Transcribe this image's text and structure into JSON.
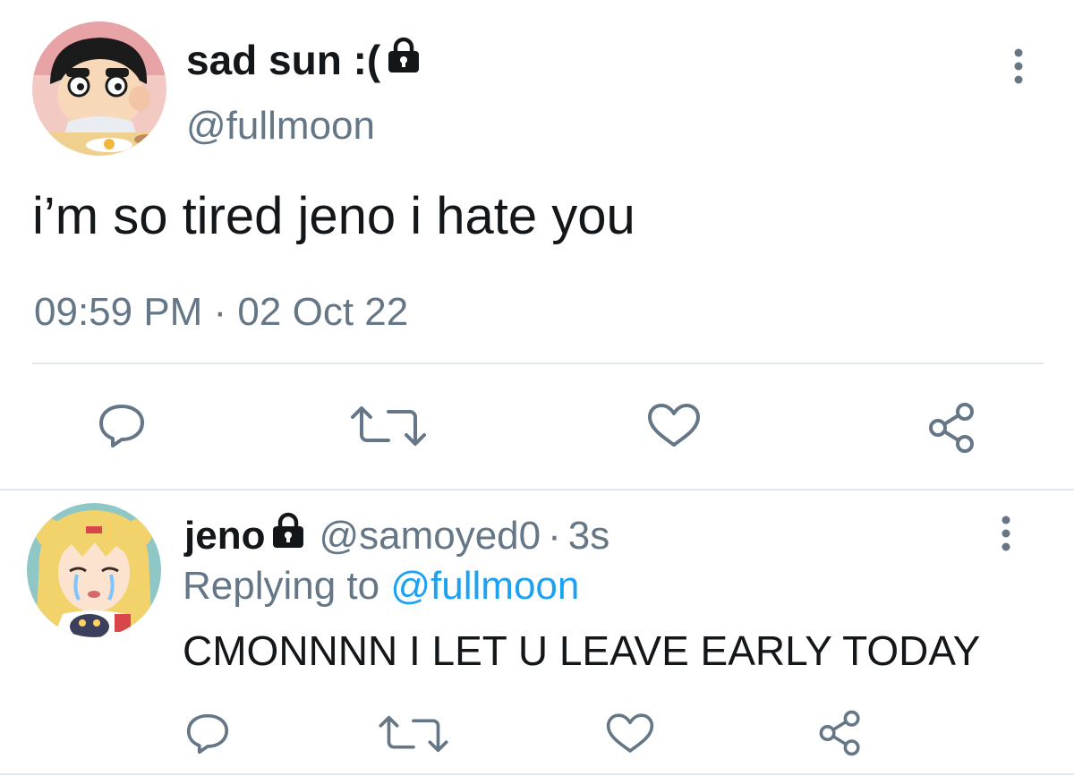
{
  "tweet": {
    "display_name": "sad sun :(",
    "handle": "@fullmoon",
    "protected_icon": "lock-icon",
    "text": "i’m so tired jeno i hate you",
    "meta": "09:59 PM · 02 Oct 22",
    "avatar_icon": "cartoon-boy-avatar",
    "actions": [
      "reply-icon",
      "retweet-icon",
      "like-icon",
      "share-icon"
    ]
  },
  "reply": {
    "display_name": "jeno",
    "handle": "@samoyed0",
    "dot": "·",
    "time": "3s",
    "replying_prefix": "Replying to",
    "replying_handle": "@fullmoon",
    "text": "CMONNNN I LET U LEAVE EARLY TODAY",
    "avatar_icon": "anime-girl-avatar",
    "actions": [
      "reply-icon",
      "retweet-icon",
      "like-icon",
      "share-icon"
    ]
  },
  "colors": {
    "text": "#14171a",
    "secondary": "#657786",
    "link": "#1da1f2",
    "divider": "#e1e8ed"
  }
}
